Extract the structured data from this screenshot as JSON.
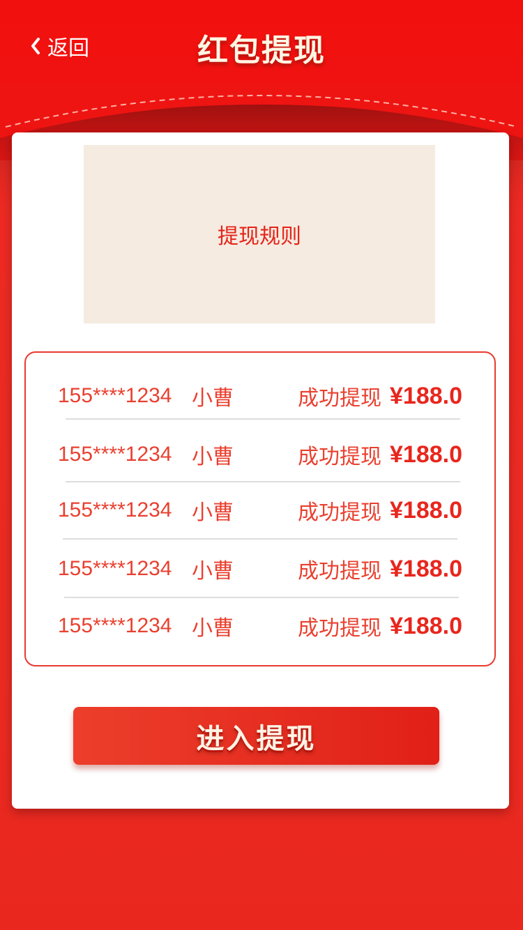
{
  "header": {
    "back_label": "返回",
    "title": "红包提现"
  },
  "rules": {
    "label": "提现规则"
  },
  "records": [
    {
      "phone": "155****1234",
      "name": "小曹",
      "status": "成功提现",
      "amount": "¥188.0"
    },
    {
      "phone": "155****1234",
      "name": "小曹",
      "status": "成功提现",
      "amount": "¥188.0"
    },
    {
      "phone": "155****1234",
      "name": "小曹",
      "status": "成功提现",
      "amount": "¥188.0"
    },
    {
      "phone": "155****1234",
      "name": "小曹",
      "status": "成功提现",
      "amount": "¥188.0"
    },
    {
      "phone": "155****1234",
      "name": "小曹",
      "status": "成功提现",
      "amount": "¥188.0"
    }
  ],
  "action": {
    "enter_label": "进入提现"
  },
  "colors": {
    "primary_red": "#ee1412",
    "text_red": "#e9402f",
    "rules_bg": "#f5ebe0",
    "title_cream": "#fff6e4"
  }
}
